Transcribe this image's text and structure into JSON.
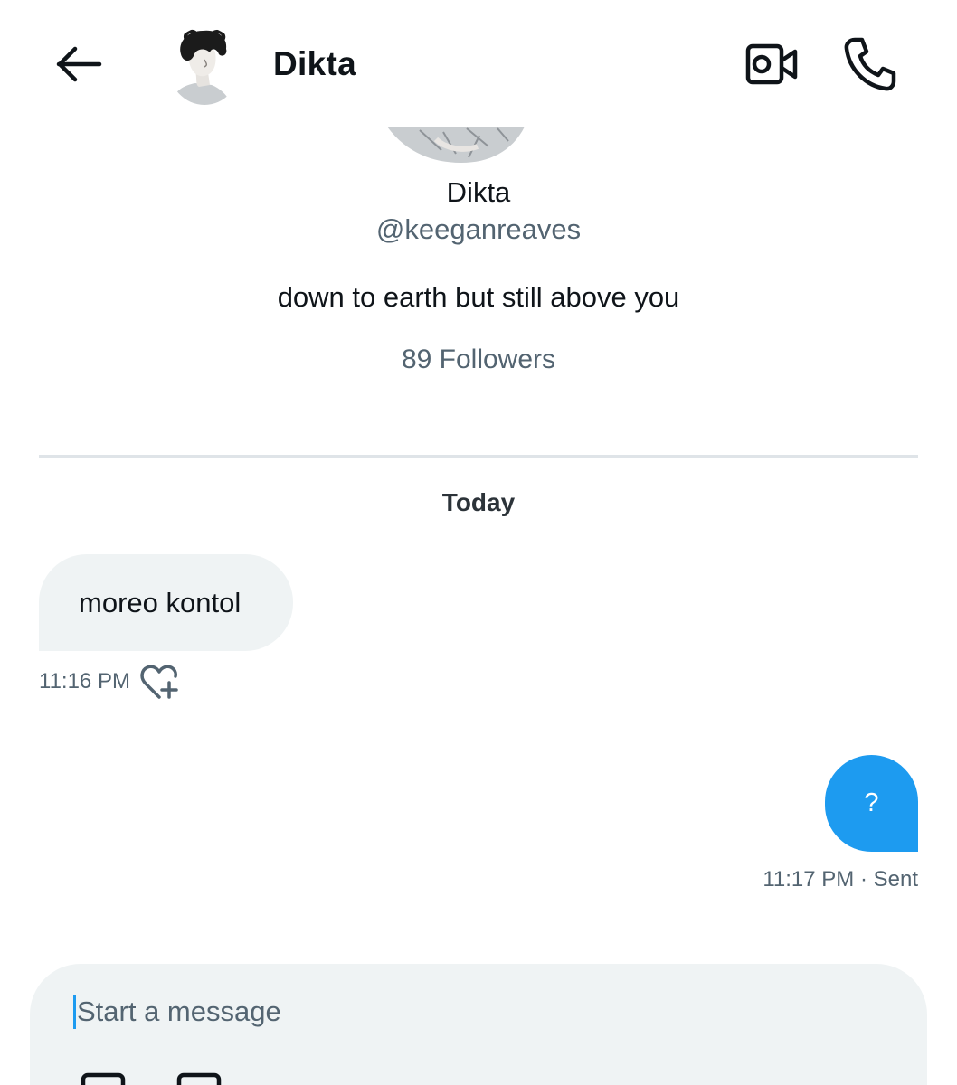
{
  "header": {
    "title": "Dikta",
    "icons": {
      "back": "arrow-left-icon",
      "video": "video-camera-icon",
      "call": "phone-icon"
    }
  },
  "profile": {
    "name": "Dikta",
    "handle": "@keeganreaves",
    "bio": "down to earth but still above you",
    "followers": "89 Followers"
  },
  "conversation": {
    "date_label": "Today",
    "messages": [
      {
        "direction": "incoming",
        "text": "moreo kontol",
        "time": "11:16 PM"
      },
      {
        "direction": "outgoing",
        "text": "?",
        "time": "11:17 PM · Sent"
      }
    ]
  },
  "composer": {
    "placeholder": "Start a message"
  },
  "colors": {
    "accent": "#1d9bf0",
    "bubble_in": "#eff3f4",
    "secondary_text": "#536471",
    "voice_icon": "#7856ff"
  }
}
